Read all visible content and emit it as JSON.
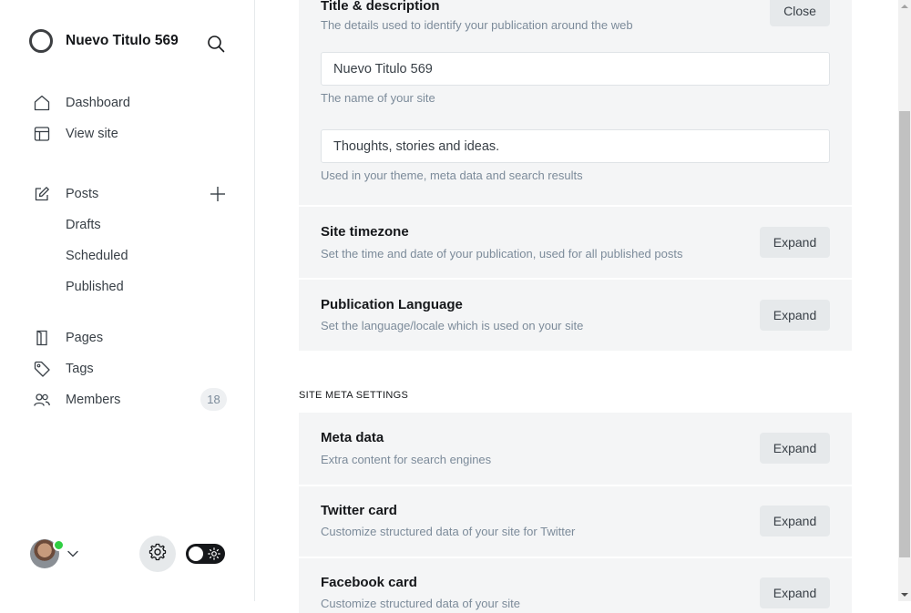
{
  "sidebar": {
    "site_name": "Nuevo Titulo 569",
    "nav": {
      "dashboard": "Dashboard",
      "view_site": "View site",
      "posts": "Posts",
      "drafts": "Drafts",
      "scheduled": "Scheduled",
      "published": "Published",
      "pages": "Pages",
      "tags": "Tags",
      "members": "Members",
      "members_count": "18"
    }
  },
  "main": {
    "title_section": {
      "title": "Title & description",
      "description": "The details used to identify your publication around the web",
      "close_label": "Close",
      "site_name_value": "Nuevo Titulo 569",
      "site_name_hint": "The name of your site",
      "description_value": "Thoughts, stories and ideas.",
      "description_hint": "Used in your theme, meta data and search results"
    },
    "timezone": {
      "title": "Site timezone",
      "description": "Set the time and date of your publication, used for all published posts",
      "button": "Expand"
    },
    "language": {
      "title": "Publication Language",
      "description": "Set the language/locale which is used on your site",
      "button": "Expand"
    },
    "meta_section_label": "SITE META SETTINGS",
    "meta_data": {
      "title": "Meta data",
      "description": "Extra content for search engines",
      "button": "Expand"
    },
    "twitter": {
      "title": "Twitter card",
      "description": "Customize structured data of your site for Twitter",
      "button": "Expand"
    },
    "facebook": {
      "title": "Facebook card",
      "description": "Customize structured data of your site",
      "button": "Expand"
    }
  }
}
